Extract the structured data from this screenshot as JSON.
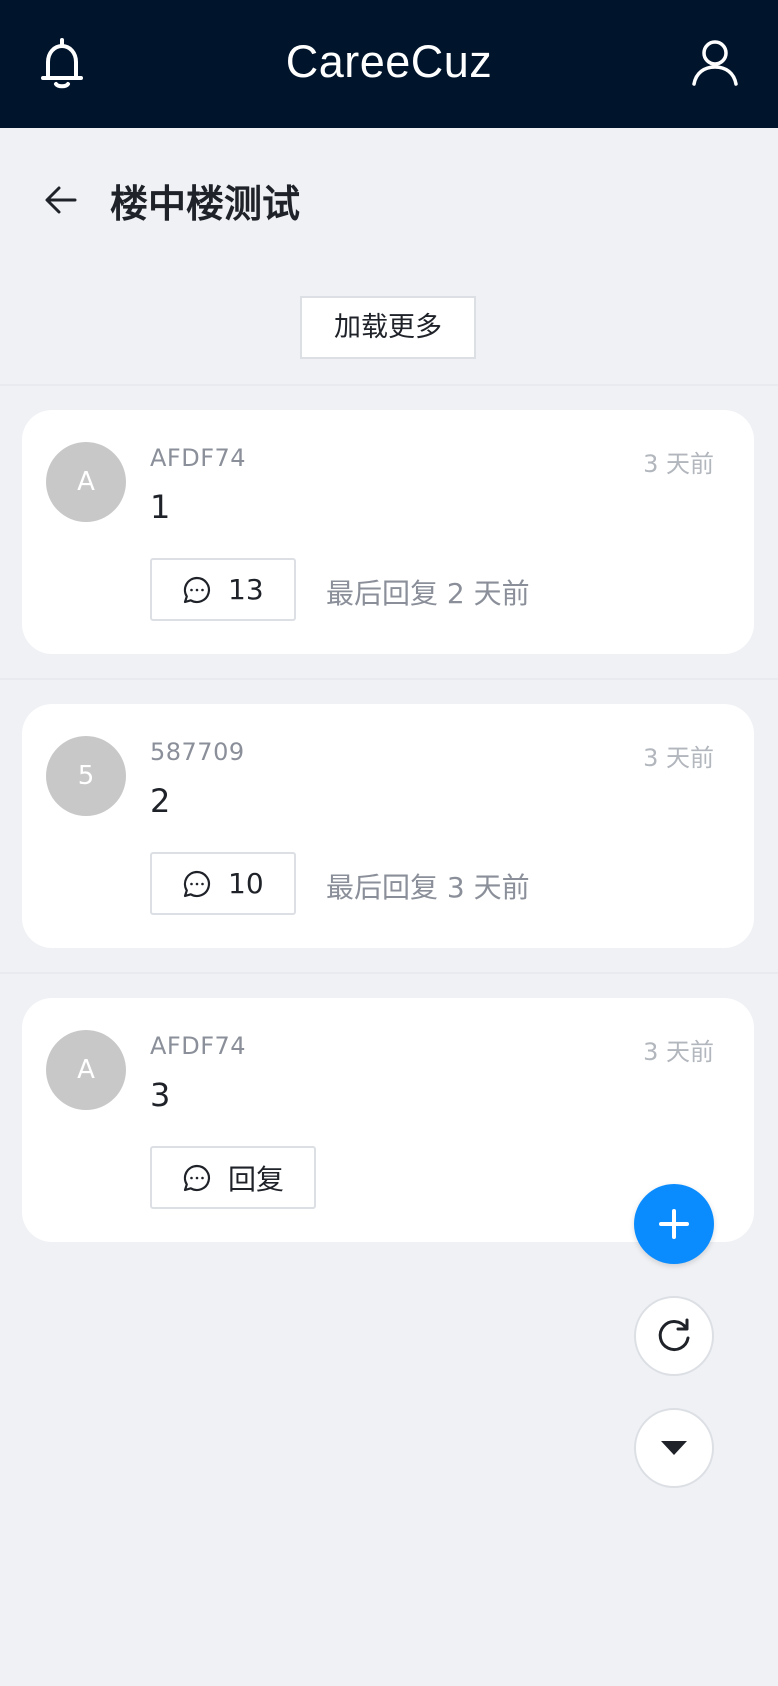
{
  "header": {
    "brand": "CareeCuz",
    "icons": [
      "bell-icon",
      "user-icon"
    ]
  },
  "page": {
    "title": "楼中楼测试",
    "back_icon": "arrow-left-icon"
  },
  "load_more_label": "加载更多",
  "posts": [
    {
      "avatar": "A",
      "author": "AFDF74",
      "time": "3 天前",
      "content": "1",
      "reply_label": "13",
      "last_reply": "最后回复 2 天前"
    },
    {
      "avatar": "5",
      "author": "587709",
      "time": "3 天前",
      "content": "2",
      "reply_label": "10",
      "last_reply": "最后回复 3 天前"
    },
    {
      "avatar": "A",
      "author": "AFDF74",
      "time": "3 天前",
      "content": "3",
      "reply_label": "回复",
      "last_reply": ""
    }
  ],
  "fabs": {
    "add_icon": "plus-icon",
    "refresh_icon": "refresh-icon",
    "scroll_down_icon": "caret-down-icon"
  },
  "colors": {
    "header_bg": "#00142b",
    "accent": "#0a8cff",
    "page_bg": "#eff1f5",
    "avatar_bg": "#c8c8c8"
  }
}
